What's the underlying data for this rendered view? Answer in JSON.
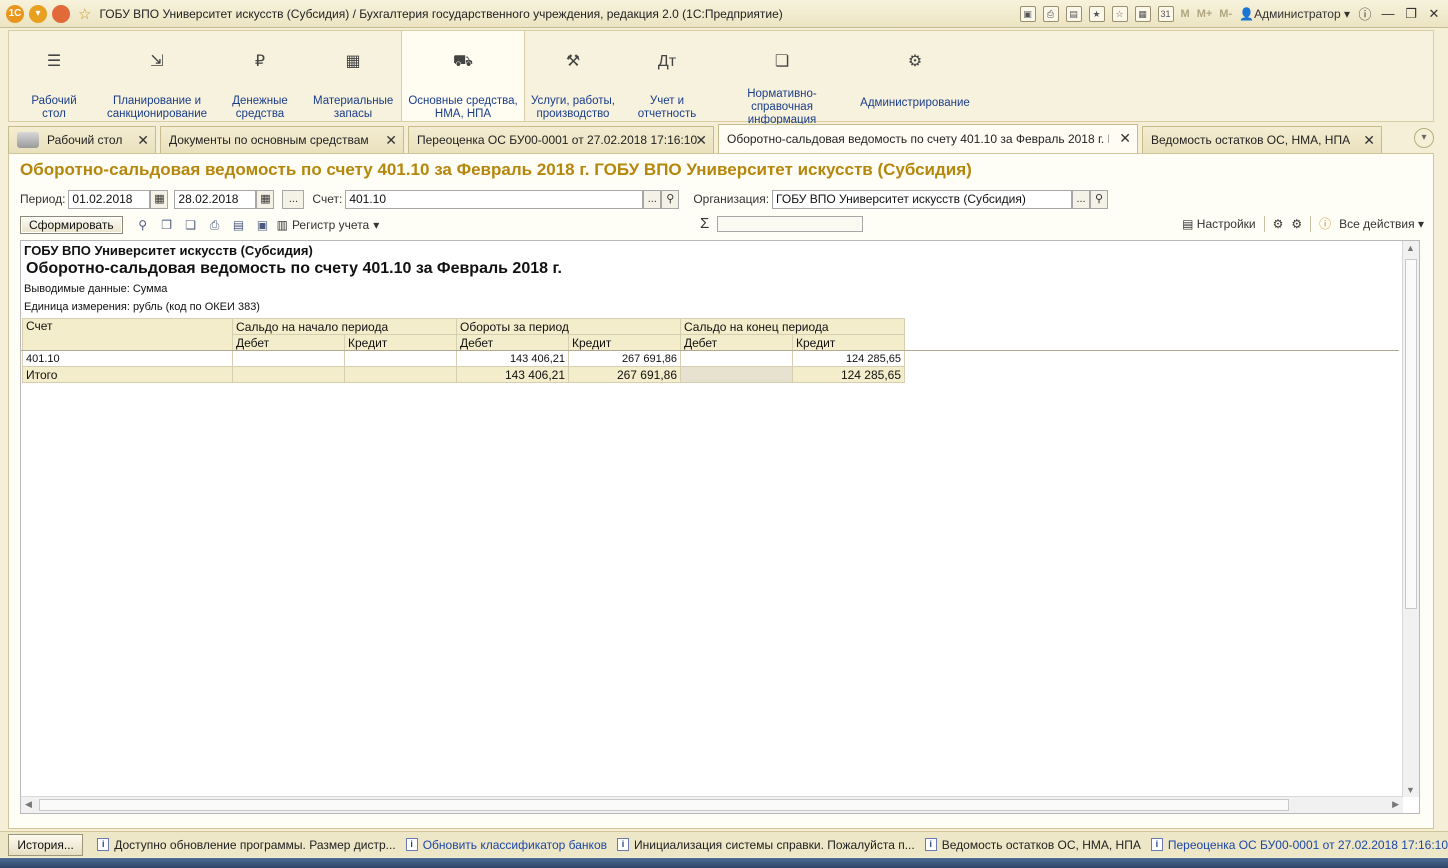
{
  "window": {
    "title": "ГОБУ ВПО Университет искусств (Субсидия) / Бухгалтерия государственного учреждения, редакция 2.0  (1С:Предприятие)",
    "user": "Администратор",
    "m_buttons": [
      "M",
      "M+",
      "M-"
    ]
  },
  "sections": [
    {
      "label": "Рабочий стол",
      "icon": "menu-icon"
    },
    {
      "label": "Планирование и санкционирование",
      "icon": "chart-icon"
    },
    {
      "label": "Денежные средства",
      "icon": "ruble-icon"
    },
    {
      "label": "Материальные запасы",
      "icon": "grid-icon"
    },
    {
      "label": "Основные средства, НМА, НПА",
      "icon": "truck-icon"
    },
    {
      "label": "Услуги, работы, производство",
      "icon": "tools-icon"
    },
    {
      "label": "Учет и отчетность",
      "icon": "ledger-icon"
    },
    {
      "label": "Нормативно-справочная информация",
      "icon": "docs-icon"
    },
    {
      "label": "Администрирование",
      "icon": "gear-icon"
    }
  ],
  "tabs": [
    {
      "label": "Рабочий стол"
    },
    {
      "label": "Документы по основным средствам"
    },
    {
      "label": "Переоценка ОС БУ00-0001 от 27.02.2018 17:16:10"
    },
    {
      "label": "Оборотно-сальдовая ведомость по счету 401.10 за Февраль 2018 г. ГОБ..."
    },
    {
      "label": "Ведомость остатков ОС, НМА, НПА"
    }
  ],
  "page": {
    "title": "Оборотно-сальдовая ведомость по счету 401.10 за Февраль 2018 г. ГОБУ ВПО Университет искусств (Субсидия)"
  },
  "params": {
    "period_label": "Период:",
    "date_from": "01.02.2018",
    "date_to": "28.02.2018",
    "dots": "...",
    "account_label": "Счет:",
    "account": "401.10",
    "org_label": "Организация:",
    "org": "ГОБУ ВПО Университет искусств (Субсидия)"
  },
  "toolbar": {
    "generate": "Сформировать",
    "register": "Регистр учета",
    "sigma": "Σ",
    "settings": "Настройки",
    "all_actions": "Все действия"
  },
  "report": {
    "org": "ГОБУ ВПО Университет искусств (Субсидия)",
    "title": "Оборотно-сальдовая ведомость по счету 401.10 за Февраль 2018 г.",
    "meta1": "Выводимые данные:  Сумма",
    "meta2": "Единица измерения: рубль (код по ОКЕИ 383)",
    "headers": {
      "account": "Счет",
      "opening": "Сальдо на начало периода",
      "turnover": "Обороты за период",
      "closing": "Сальдо на конец периода",
      "debit": "Дебет",
      "credit": "Кредит"
    },
    "row": {
      "account": "401.10",
      "open_debit": "",
      "open_credit": "",
      "turn_debit": "143 406,21",
      "turn_credit": "267 691,86",
      "close_debit": "",
      "close_credit": "124 285,65"
    },
    "total": {
      "label": "Итого",
      "open_debit": "",
      "open_credit": "",
      "turn_debit": "143 406,21",
      "turn_credit": "267 691,86",
      "close_debit": "",
      "close_credit": "124 285,65"
    }
  },
  "status": {
    "history": "История...",
    "notifications": [
      {
        "text": "Доступно обновление программы. Размер дистр...",
        "link": false
      },
      {
        "text": "Обновить классификатор банков",
        "link": true
      },
      {
        "text": "Инициализация системы справки. Пожалуйста п...",
        "link": false
      },
      {
        "text": "Ведомость остатков ОС, НМА, НПА",
        "link": false
      },
      {
        "text": "Переоценка ОС БУ00-0001 от 27.02.2018 17:16:10",
        "link": true
      }
    ]
  }
}
